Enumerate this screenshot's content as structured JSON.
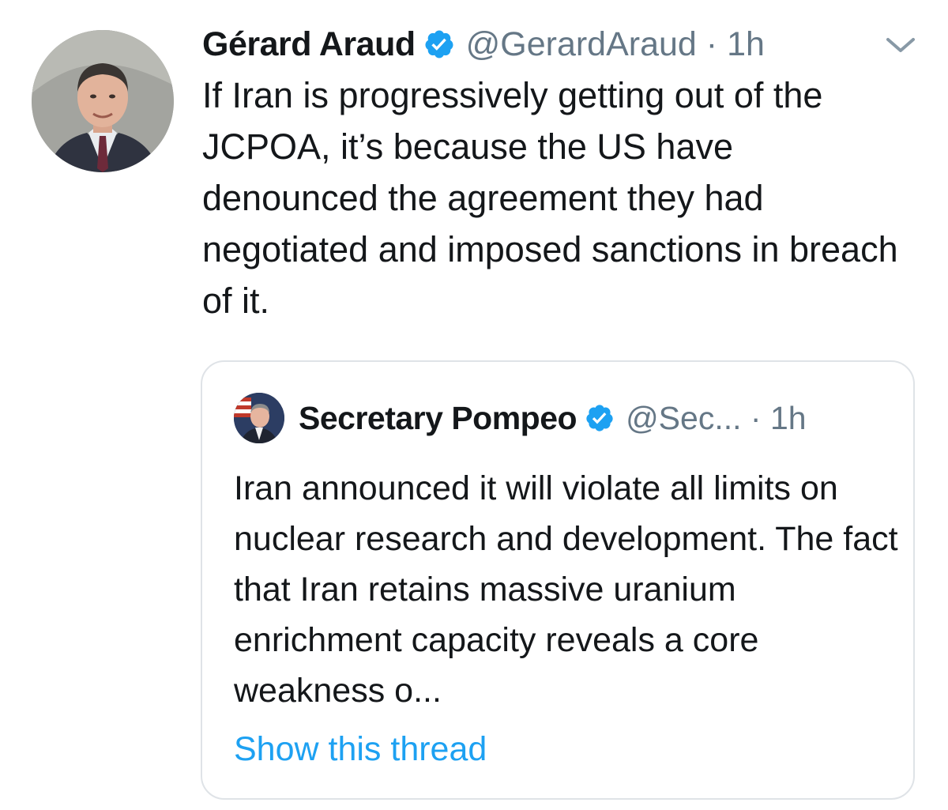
{
  "tweet": {
    "author_name": "Gérard Araud",
    "handle": "@GerardAraud",
    "separator": "·",
    "time": "1h",
    "text": "If Iran is progressively getting out of the JCPOA, it’s because the US have denounced the agreement they had negotiated and imposed sanctions in breach of it."
  },
  "quoted_tweet": {
    "author_name": "Secretary Pompeo",
    "handle": "@Sec...",
    "separator": "·",
    "time": "1h",
    "text": "Iran announced it will violate all limits on nuclear research and development. The fact that Iran retains massive uranium enrichment capacity reveals a core weakness o...",
    "show_thread_label": "Show this thread"
  },
  "icons": {
    "verified": "verified-badge-icon",
    "menu": "chevron-down-icon"
  },
  "colors": {
    "accent": "#1da1f2",
    "text": "#14171a",
    "secondary": "#657786",
    "border": "#dfe3e7"
  }
}
